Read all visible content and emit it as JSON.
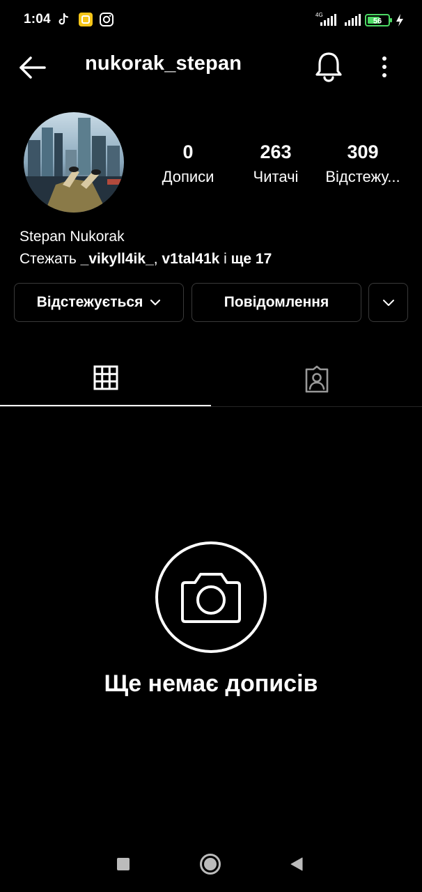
{
  "status_bar": {
    "time": "1:04",
    "network_label": "4G",
    "battery_level": "56",
    "icons": [
      "tiktok-icon",
      "notes-app-icon",
      "instagram-icon",
      "signal-icon",
      "signal-icon",
      "battery-icon",
      "charging-icon"
    ]
  },
  "header": {
    "username": "nukorak_stepan",
    "icons": [
      "back-arrow-icon",
      "bell-icon",
      "more-vertical-icon"
    ]
  },
  "profile": {
    "stats": {
      "posts_count": "0",
      "posts_label": "Дописи",
      "followers_count": "263",
      "followers_label": "Читачі",
      "following_count": "309",
      "following_label": "Відстежу..."
    },
    "full_name": "Stepan Nukorak",
    "followed_by": {
      "prefix": "Стежать ",
      "user1": "_vikyll4ik_",
      "sep": ", ",
      "user2": "v1tal41k",
      "mid": " і ",
      "more": "ще 17"
    }
  },
  "actions": {
    "following_label": "Відстежується",
    "message_label": "Повідомлення"
  },
  "tabs": {
    "icons": [
      "grid-icon",
      "tagged-person-icon"
    ],
    "active": "grid"
  },
  "empty_state": {
    "icon": "camera-icon",
    "text": "Ще немає дописів"
  },
  "nav_bar": {
    "icons": [
      "recents-square-icon",
      "home-circle-icon",
      "back-triangle-icon"
    ]
  },
  "colors": {
    "background": "#000000",
    "text": "#ffffff",
    "button_border": "#3a3a3a",
    "battery_fill": "#4cd964"
  }
}
